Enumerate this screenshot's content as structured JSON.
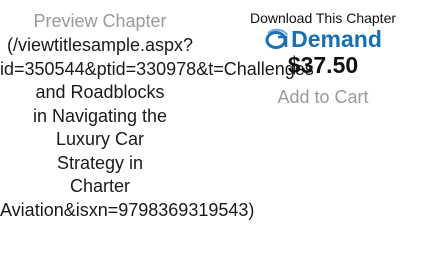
{
  "preview": {
    "label": "Preview Chapter",
    "url_text": "(/viewtitlesample.aspx?\nid=350544&ptid=330978&t=Challenges\nand Roadblocks\nin Navigating the\nLuxury Car\nStrategy in\nCharter\nAviation&isxn=9798369319543)"
  },
  "download": {
    "heading": "Download This Chapter",
    "brand_prefix": "On",
    "brand_suffix": "Demand",
    "price": "$37.50",
    "add_to_cart_label": "Add to Cart"
  },
  "colors": {
    "brand": "#1a6fb3",
    "muted": "#9a9a9a",
    "text": "#111111"
  }
}
